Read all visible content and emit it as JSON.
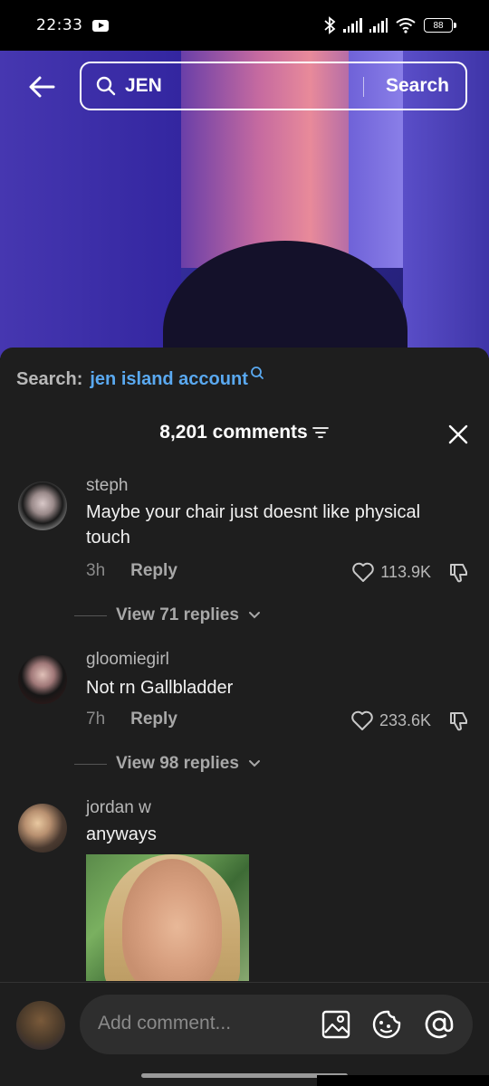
{
  "status": {
    "time": "22:33",
    "battery": "88"
  },
  "search": {
    "query": "JEN",
    "button": "Search"
  },
  "suggestion": {
    "label": "Search:",
    "query": "jen island account"
  },
  "comments_header": {
    "count": "8,201 comments"
  },
  "comments": [
    {
      "user": "steph",
      "text": "Maybe your chair just doesnt like physical touch",
      "time": "3h",
      "reply": "Reply",
      "likes": "113.9K",
      "view_replies": "View 71 replies"
    },
    {
      "user": "gloomiegirl",
      "text": "Not rn Gallbladder",
      "time": "7h",
      "reply": "Reply",
      "likes": "233.6K",
      "view_replies": "View 98 replies"
    },
    {
      "user": "jordan w",
      "text": "anyways"
    }
  ],
  "input": {
    "placeholder": "Add comment..."
  },
  "colors": {
    "accent_link": "#5aa9f0",
    "sheet_bg": "#1e1e1e"
  }
}
